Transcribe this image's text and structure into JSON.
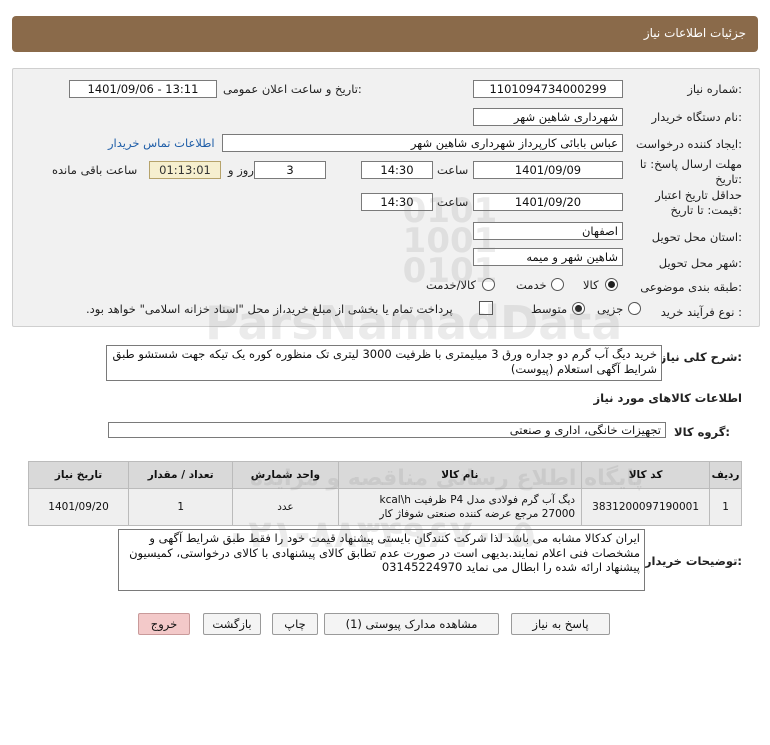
{
  "header": {
    "title": "جزئیات اطلاعات نیاز"
  },
  "form": {
    "need_number_label": "شماره نیاز:",
    "need_number": "1101094734000299",
    "announce_label": "تاریخ و ساعت اعلان عمومی:",
    "announce_value": "1401/09/06 - 13:11",
    "buyer_org_label": "نام دستگاه خریدار:",
    "buyer_org": "شهرداری شاهین شهر",
    "creator_label": "ایجاد کننده درخواست:",
    "creator": "عباس بابائی کارپرداز شهرداری شاهین شهر",
    "contact_link": "اطلاعات تماس خریدار",
    "deadline_label_1": "مهلت ارسال پاسخ: تا",
    "deadline_label_2": "تاریخ:",
    "deadline_date": "1401/09/09",
    "time_label": "ساعت",
    "deadline_time": "14:30",
    "days_value": "3",
    "days_label": "روز و",
    "remaining_time": "01:13:01",
    "remaining_label": "ساعت باقی مانده",
    "validity_label_1": "حداقل تاریخ اعتبار",
    "validity_label_2": "قیمت: تا تاریخ:",
    "validity_date": "1401/09/20",
    "validity_time": "14:30",
    "province_label": "استان محل تحویل:",
    "province": "اصفهان",
    "city_label": "شهر محل تحویل:",
    "city": "شاهین شهر و میمه",
    "category_label": "طبقه بندی موضوعی:",
    "category_options": [
      "کالا",
      "خدمت",
      "کالا/خدمت"
    ],
    "category_selected": "کالا",
    "process_label": "نوع فرآیند خرید :",
    "process_options": [
      "جزیی",
      "متوسط"
    ],
    "process_selected": "متوسط",
    "payment_note": "پرداخت تمام یا بخشی از مبلغ خرید،از محل \"اسناد خزانه اسلامی\" خواهد بود."
  },
  "summary": {
    "label": "شرح کلی نیاز:",
    "text": "خرید دیگ آب گرم دو جداره ورق 3 میلیمتری با ظرفیت 3000 لیتری تک منظوره کوره یک تیکه جهت شستشو طبق شرایط آگهی استعلام (پیوست)"
  },
  "goods_section": {
    "title": "اطلاعات کالاهای مورد نیاز"
  },
  "group": {
    "label": "گروه کالا:",
    "value": "تجهیزات خانگی، اداری و صنعتی"
  },
  "table": {
    "headers": [
      "ردیف",
      "کد کالا",
      "نام کالا",
      "واحد شمارش",
      "تعداد / مقدار",
      "تاریخ نیاز"
    ],
    "rows": [
      {
        "index": "1",
        "code": "3831200097190001",
        "name": "دیگ آب گرم فولادی مدل P4 ظرفیت kcal\\h 27000 مرجع عرضه کننده صنعتی شوفاژ کار",
        "unit": "عدد",
        "qty": "1",
        "date": "1401/09/20"
      }
    ]
  },
  "notes": {
    "label": "توضیحات خریدار:",
    "text": "ایران کدکالا مشابه می باشد لذا شرکت کنندگان بایستی پیشنهاد قیمت خود را فقط طبق شرایط آگهی و مشخصات فنی اعلام نمایند.بدیهی است در صورت عدم تطابق کالای پیشنهادی با کالای درخواستی، کمیسیون پیشنهاد ارائه شده را ابطال می نماید 03145224970"
  },
  "buttons": {
    "reply": "پاسخ به نیاز",
    "attachments": "مشاهده مدارک پیوستی (1)",
    "print": "چاپ",
    "back": "بازگشت",
    "exit": "خروج"
  },
  "watermark": {
    "brand": "ParsNamadData",
    "subtitle": "پایگاه اطلاع رسانی مناقصه و مزایده",
    "phone": "۰۲۱-۸۸۳۴۹۶۷۰-۵",
    "numbers": "0101 1001 0101"
  },
  "colors": {
    "header_bg": "#8a6a4a",
    "panel_bg": "#f1f1f1",
    "link": "#1f5ea8",
    "remaining_bg": "#f6efcf",
    "exit_btn": "#f3c9c9"
  }
}
